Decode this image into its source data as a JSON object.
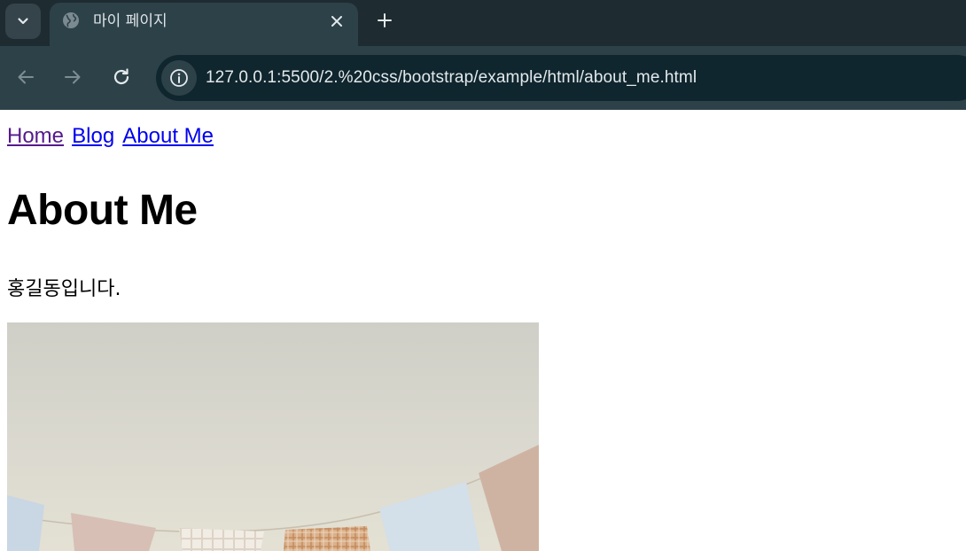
{
  "browser": {
    "tab": {
      "title": "마이 페이지",
      "favicon": "globe-icon"
    },
    "address_bar": {
      "url": "127.0.0.1:5500/2.%20css/bootstrap/example/html/about_me.html"
    },
    "icons": {
      "tab_search": "chevron-down-icon",
      "close": "close-icon",
      "new_tab": "plus-icon",
      "back": "arrow-left-icon",
      "forward": "arrow-right-icon",
      "reload": "reload-icon",
      "site_info": "info-icon"
    },
    "colors": {
      "tabstrip": "#1e2b30",
      "toolbar": "#2d4148",
      "omnibox": "#10262e"
    }
  },
  "page": {
    "nav": [
      {
        "label": "Home",
        "state": "visited"
      },
      {
        "label": "Blog",
        "state": "link"
      },
      {
        "label": "About Me",
        "state": "link"
      }
    ],
    "title": "About Me",
    "intro": "홍길동입니다.",
    "colors": {
      "link": "#0000ee",
      "visited_link": "#551a8b"
    }
  }
}
